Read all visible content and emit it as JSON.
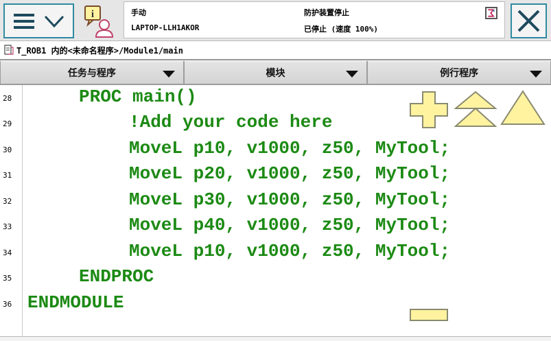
{
  "header": {
    "mode": "手动",
    "system_name": "LAPTOP-LLH1AKOR",
    "state": "防护装置停止",
    "speed_status": "已停止 (速度 100%)"
  },
  "breadcrumb": {
    "path": "T_ROB1 内的<未命名程序>/Module1/main"
  },
  "dropdowns": [
    {
      "label": "任务与程序"
    },
    {
      "label": "模块"
    },
    {
      "label": "例行程序"
    }
  ],
  "code_lines": [
    {
      "num": "28",
      "text": "PROC main()"
    },
    {
      "num": "29",
      "text": "!Add your code here"
    },
    {
      "num": "30",
      "text": "MoveL p10, v1000, z50, MyTool;"
    },
    {
      "num": "31",
      "text": "MoveL p20, v1000, z50, MyTool;"
    },
    {
      "num": "32",
      "text": "MoveL p30, v1000, z50, MyTool;"
    },
    {
      "num": "33",
      "text": "MoveL p40, v1000, z50, MyTool;"
    },
    {
      "num": "34",
      "text": "MoveL p10, v1000, z50, MyTool;"
    },
    {
      "num": "35",
      "text": "ENDPROC"
    },
    {
      "num": "36",
      "text": "ENDMODULE"
    }
  ],
  "colors": {
    "code": "#1c8a14",
    "control_fill": "#fff3a0",
    "control_stroke": "#8a8a70",
    "button_border": "#2e8aa1"
  },
  "icons": [
    "menu-icon",
    "chevron-down-icon",
    "robot-info-icon",
    "status-icon",
    "close-icon",
    "document-icon",
    "zoom-in-icon",
    "page-up-icon",
    "top-icon",
    "zoom-out-icon"
  ]
}
